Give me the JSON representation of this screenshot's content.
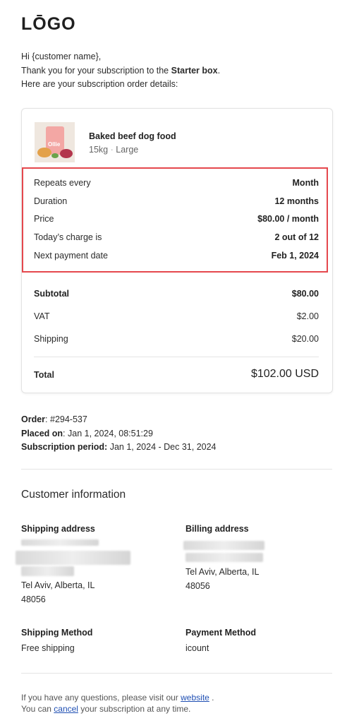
{
  "logo": "LŌGO",
  "intro": {
    "greeting": "Hi {customer name},",
    "thanks_prefix": "Thank you for your subscription to the ",
    "box_name": "Starter box",
    "thanks_suffix": ".",
    "details_line": "Here are your subscription order details:"
  },
  "product": {
    "name": "Baked beef dog food",
    "weight": "15kg",
    "separator": "·",
    "size": "Large",
    "bag_text": "Ollie"
  },
  "schedule": [
    {
      "label": "Repeats every",
      "value": "Month"
    },
    {
      "label": "Duration",
      "value": "12 months"
    },
    {
      "label": "Price",
      "value": "$80.00 / month"
    },
    {
      "label": "Today’s charge is",
      "value": "2 out of 12"
    },
    {
      "label": "Next payment date",
      "value": "Feb 1, 2024"
    }
  ],
  "summary": {
    "subtotal_label": "Subtotal",
    "subtotal_value": "$80.00",
    "vat_label": "VAT",
    "vat_value": "$2.00",
    "shipping_label": "Shipping",
    "shipping_value": "$20.00",
    "total_label": "Total",
    "total_value": "$102.00 USD"
  },
  "order": {
    "order_label": "Order",
    "order_value": ": #294-537",
    "placed_label": "Placed on",
    "placed_value": ": Jan 1, 2024, 08:51:29",
    "period_label": "Subscription period:",
    "period_value": " Jan 1, 2024 - Dec 31, 2024"
  },
  "customer": {
    "heading": "Customer information",
    "shipping_address_label": "Shipping address",
    "shipping_city": "Tel Aviv, Alberta, IL",
    "shipping_zip": "48056",
    "billing_address_label": "Billing address",
    "billing_city": "Tel Aviv, Alberta, IL",
    "billing_zip": "48056",
    "shipping_method_label": "Shipping Method",
    "shipping_method_value": "Free shipping",
    "payment_method_label": "Payment Method",
    "payment_method_value": "icount"
  },
  "footer": {
    "line1_prefix": "If you have any questions, please visit our ",
    "website_link": "website",
    "line1_suffix": " .",
    "line2_prefix": "You can ",
    "cancel_link": "cancel",
    "line2_suffix": " your subscription at any time."
  },
  "colors": {
    "highlight": "#e5484d",
    "link": "#1f4fb3"
  }
}
